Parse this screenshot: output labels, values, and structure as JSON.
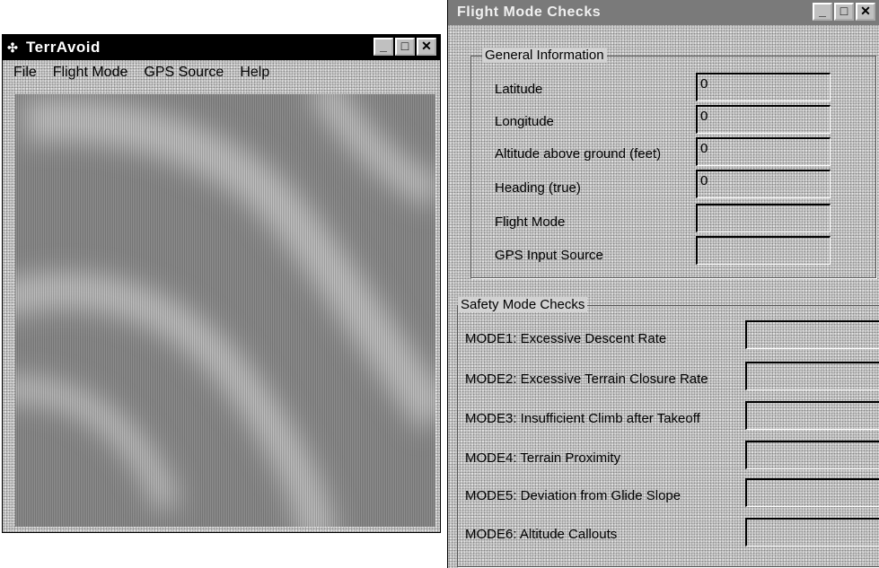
{
  "terravoid": {
    "title": "TerrAvoid",
    "icon": "terravoid-app-icon",
    "menu": [
      "File",
      "Flight Mode",
      "GPS Source",
      "Help"
    ],
    "window_buttons": {
      "minimize": "_",
      "maximize": "□",
      "close": "✕"
    }
  },
  "flight_mode_checks": {
    "title": "Flight Mode Checks",
    "window_buttons": {
      "minimize": "_",
      "maximize": "□",
      "close": "✕"
    },
    "general_information": {
      "legend": "General Information",
      "fields": [
        {
          "label": "Latitude",
          "value": "0"
        },
        {
          "label": "Longitude",
          "value": "0"
        },
        {
          "label": "Altitude above ground (feet)",
          "value": "0"
        },
        {
          "label": "Heading (true)",
          "value": "0"
        },
        {
          "label": "Flight Mode",
          "value": ""
        },
        {
          "label": "GPS Input Source",
          "value": ""
        }
      ]
    },
    "safety_mode_checks": {
      "legend": "Safety Mode Checks",
      "modes": [
        {
          "label": "MODE1: Excessive Descent Rate",
          "value": ""
        },
        {
          "label": "MODE2: Excessive Terrain Closure Rate",
          "value": ""
        },
        {
          "label": "MODE3: Insufficient Climb after Takeoff",
          "value": ""
        },
        {
          "label": "MODE4: Terrain Proximity",
          "value": ""
        },
        {
          "label": "MODE5: Deviation from Glide Slope",
          "value": ""
        },
        {
          "label": "MODE6: Altitude Callouts",
          "value": ""
        }
      ]
    }
  },
  "colors": {
    "terrain_dark": "#8c8c8c",
    "terrain_light": "#bdbdbd",
    "dialog_bg": "#d2d2d2"
  }
}
